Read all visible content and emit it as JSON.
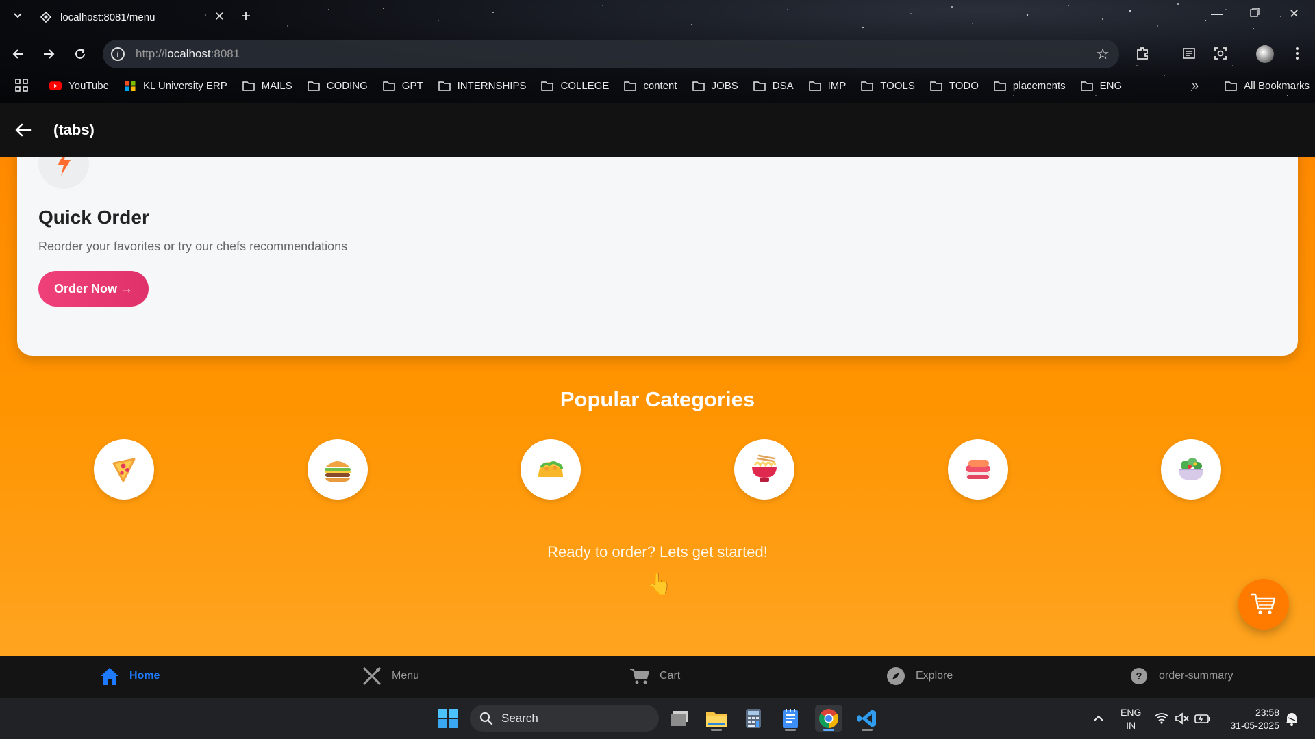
{
  "browser": {
    "tab_title": "localhost:8081/menu",
    "url_scheme": "http://",
    "url_host": "localhost",
    "url_port": ":8081",
    "bookmarks": [
      "YouTube",
      "KL University ERP",
      "MAILS",
      "CODING",
      "GPT",
      "INTERNSHIPS",
      "COLLEGE",
      "content",
      "JOBS",
      "DSA",
      "IMP",
      "TOOLS",
      "TODO",
      "placements",
      "ENG"
    ],
    "all_bookmarks": "All Bookmarks"
  },
  "header": {
    "title": "(tabs)"
  },
  "quick_order": {
    "title": "Quick Order",
    "subtitle": "Reorder your favorites or try our chefs recommendations",
    "button": "Order Now →"
  },
  "categories": {
    "title": "Popular Categories",
    "items": [
      "pizza-icon",
      "burger-icon",
      "taco-icon",
      "noodle-bowl-icon",
      "sushi-icon",
      "salad-icon"
    ]
  },
  "cta": {
    "text": "Ready to order? Lets get started!"
  },
  "tabbar": {
    "items": [
      {
        "label": "Home",
        "icon": "home-icon",
        "active": true
      },
      {
        "label": "Menu",
        "icon": "utensils-icon",
        "active": false
      },
      {
        "label": "Cart",
        "icon": "cart-icon",
        "active": false
      },
      {
        "label": "Explore",
        "icon": "compass-icon",
        "active": false
      },
      {
        "label": "order-summary",
        "icon": "help-circle-icon",
        "active": false
      }
    ]
  },
  "taskbar": {
    "search_placeholder": "Search",
    "lang_top": "ENG",
    "lang_bottom": "IN",
    "time": "23:58",
    "date": "31-05-2025"
  },
  "colors": {
    "accent_orange": "#ff8a00",
    "button_pink": "#ef3f7a",
    "tab_active_blue": "#1e7bff"
  }
}
